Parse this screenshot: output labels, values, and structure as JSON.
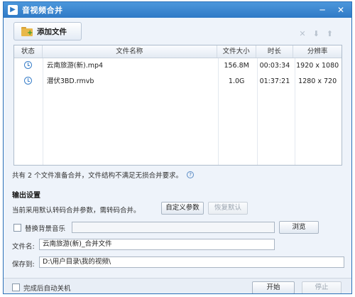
{
  "window": {
    "title": "音视频合并"
  },
  "titlebar": {
    "icons": [
      "minimize-icon",
      "close-icon"
    ],
    "minimize_glyph": "─",
    "close_glyph": "✕"
  },
  "toolbar": {
    "add_file_label": "添加文件",
    "delete_glyph": "✕",
    "move_down_glyph": "⬇",
    "move_up_glyph": "⬆"
  },
  "table": {
    "columns": [
      "状态",
      "文件名称",
      "文件大小",
      "时长",
      "分辨率"
    ],
    "rows": [
      {
        "name": "云南旅游(新).mp4",
        "size": "156.8M",
        "duration": "00:03:34",
        "resolution": "1920 x 1080"
      },
      {
        "name": "潜伏3BD.rmvb",
        "size": "1.0G",
        "duration": "01:37:21",
        "resolution": "1280 x 720"
      }
    ]
  },
  "summary": {
    "text": "共有 2 个文件准备合并，文件结构不满足无损合并要求。",
    "help_glyph": "?"
  },
  "output": {
    "section_title": "输出设置",
    "param_text": "当前采用默认转码合并参数，需转码合并。",
    "custom_params_label": "自定义参数",
    "restore_default_label": "恢复默认",
    "bg_music_label": "替换背景音乐",
    "bg_music_value": "",
    "browse_label": "浏览",
    "filename_label": "文件名:",
    "filename_value": "云南旅游(新)_合并文件",
    "saveto_label": "保存到:",
    "saveto_value": "D:\\用户目录\\我的视频\\"
  },
  "footer": {
    "auto_shutdown_label": "完成后自动关机",
    "merge_label": "开始",
    "stop_label": "停止"
  },
  "colors": {
    "titlebar": "#2f7ac6",
    "accent": "#3a7fc9"
  }
}
